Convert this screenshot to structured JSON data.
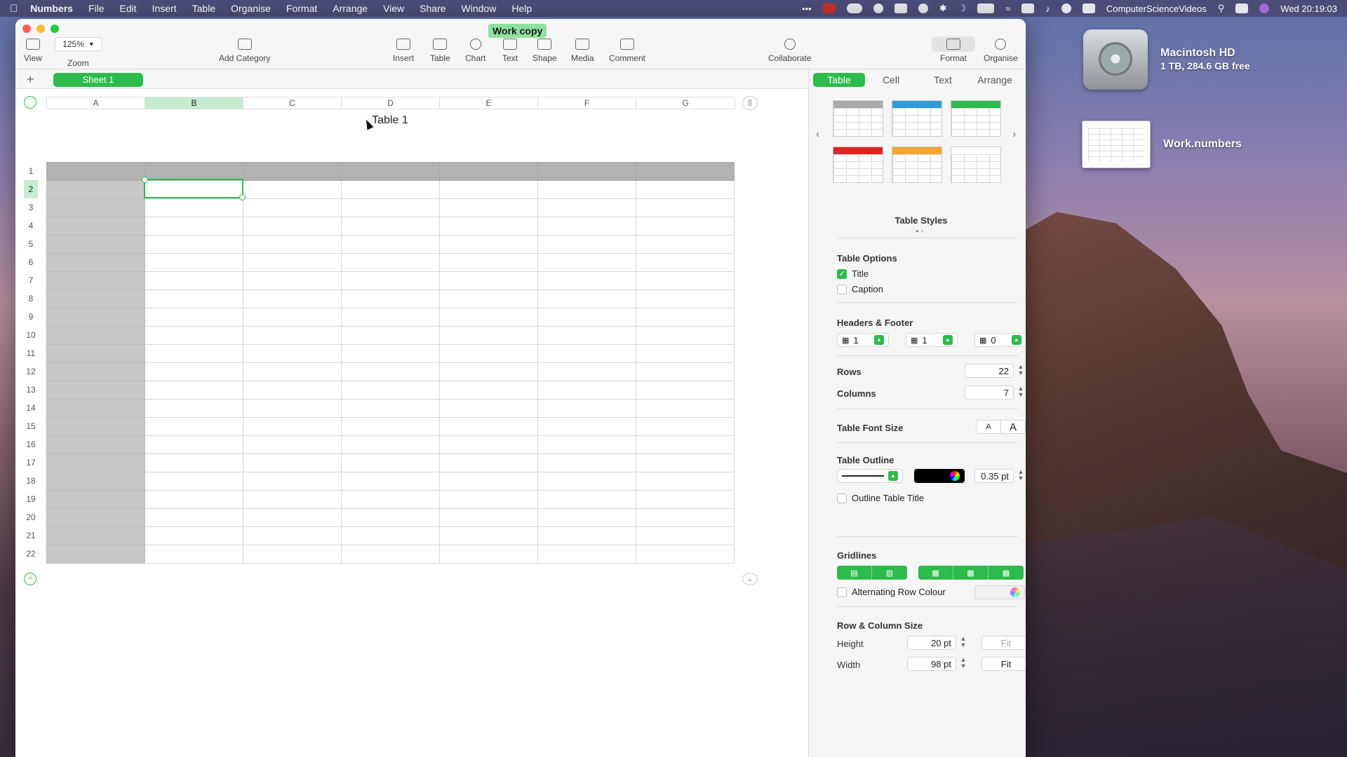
{
  "menubar": {
    "app": "Numbers",
    "items": [
      "File",
      "Edit",
      "Insert",
      "Table",
      "Organise",
      "Format",
      "Arrange",
      "View",
      "Share",
      "Window",
      "Help"
    ],
    "user": "ComputerScienceVideos",
    "clock": "Wed  20:19:03"
  },
  "desktop": {
    "hd_name": "Macintosh HD",
    "hd_info": "1 TB, 284.6 GB free",
    "file_name": "Work.numbers"
  },
  "window": {
    "title": "Work copy",
    "toolbar": {
      "zoom_value": "125%",
      "view": "View",
      "zoom": "Zoom",
      "add_category": "Add Category",
      "insert": "Insert",
      "table": "Table",
      "chart": "Chart",
      "text": "Text",
      "shape": "Shape",
      "media": "Media",
      "comment": "Comment",
      "collaborate": "Collaborate",
      "format": "Format",
      "organise": "Organise"
    },
    "sheet_tab": "Sheet 1"
  },
  "sheet": {
    "table_title": "Table 1",
    "columns": [
      "A",
      "B",
      "C",
      "D",
      "E",
      "F",
      "G"
    ],
    "rows": [
      "1",
      "2",
      "3",
      "4",
      "5",
      "6",
      "7",
      "8",
      "9",
      "10",
      "11",
      "12",
      "13",
      "14",
      "15",
      "16",
      "17",
      "18",
      "19",
      "20",
      "21",
      "22"
    ],
    "selected_column": "B",
    "selected_row": "2"
  },
  "inspector": {
    "tabs": [
      "Table",
      "Cell",
      "Text",
      "Arrange"
    ],
    "active_tab": "Table",
    "style_colors": [
      "#a9a9a9",
      "#2d9cdb",
      "#2dbb4c",
      "#e02424",
      "#f0a830",
      "#ffffff"
    ],
    "table_styles_label": "Table Styles",
    "table_options": {
      "title": "Table Options",
      "title_opt": "Title",
      "caption_opt": "Caption"
    },
    "headers_footer": {
      "title": "Headers & Footer",
      "header_rows": "1",
      "header_cols": "1",
      "footer_rows": "0"
    },
    "rows_label": "Rows",
    "rows_value": "22",
    "columns_label": "Columns",
    "columns_value": "7",
    "font_size_label": "Table Font Size",
    "font_small": "A",
    "font_large": "A",
    "outline": {
      "title": "Table Outline",
      "width": "0.35 pt",
      "outline_title_opt": "Outline Table Title"
    },
    "gridlines_title": "Gridlines",
    "alt_row_label": "Alternating Row Colour",
    "size": {
      "title": "Row & Column Size",
      "height_label": "Height",
      "height_value": "20 pt",
      "width_label": "Width",
      "width_value": "98 pt",
      "fit": "Fit"
    }
  }
}
